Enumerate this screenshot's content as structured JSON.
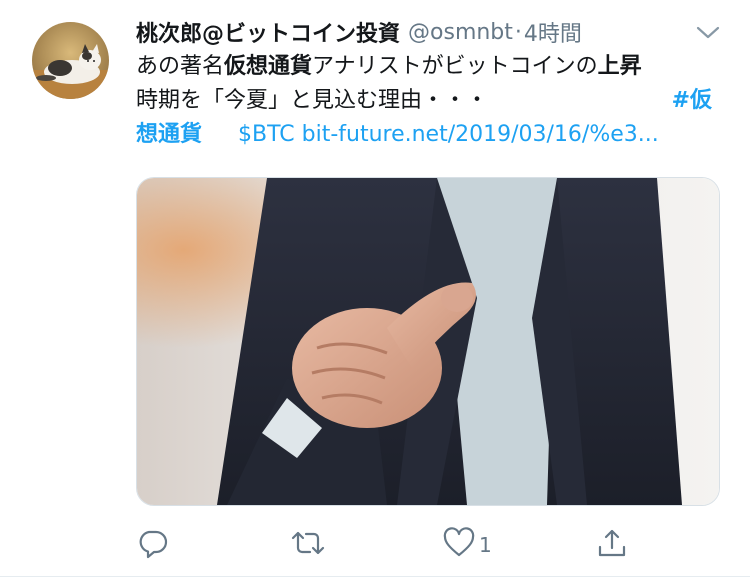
{
  "tweet": {
    "display_name": "桃次郎@ビットコイン投資",
    "handle": "@osmnbt",
    "separator": "·",
    "timestamp": "4時間",
    "body": {
      "line1_pre": "あの著名",
      "line1_bold": "仮想通貨",
      "line1_mid": "アナリストがビットコインの",
      "line1_bold2": "上昇",
      "line2_text": "時期を「今夏」と見込む理由・・・",
      "line2_hashtag": "#仮",
      "line3_hashtag": "想通貨",
      "line3_cashtag": "$BTC",
      "line3_url": "bit-future.net/2019/03/16/%e3..."
    },
    "actions": {
      "reply_icon": "reply-icon",
      "retweet_icon": "retweet-icon",
      "like_icon": "heart-icon",
      "like_count": "1",
      "share_icon": "share-icon"
    },
    "colors": {
      "link": "#1da1f2",
      "secondary_text": "#657786",
      "primary_text": "#14171a"
    }
  }
}
